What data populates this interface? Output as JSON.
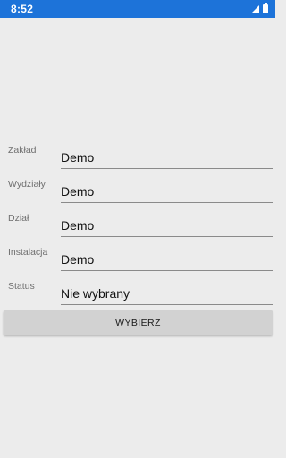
{
  "status_bar": {
    "time": "8:52",
    "icons": [
      "signal-icon",
      "battery-icon"
    ],
    "background_color": "#1d73d9"
  },
  "form": {
    "fields": [
      {
        "label": "Zakład",
        "value": "Demo"
      },
      {
        "label": "Wydziały",
        "value": "Demo"
      },
      {
        "label": "Dział",
        "value": "Demo"
      },
      {
        "label": "Instalacja",
        "value": "Demo"
      },
      {
        "label": "Status",
        "value": "Nie wybrany"
      }
    ],
    "select_button_label": "WYBIERZ"
  }
}
